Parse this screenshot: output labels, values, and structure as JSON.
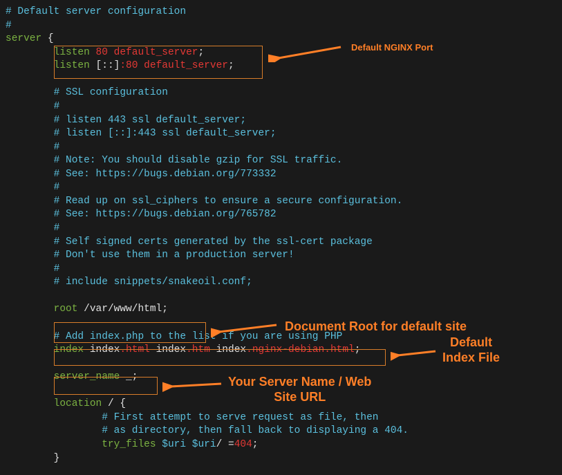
{
  "code": {
    "l1": "# Default server configuration",
    "l2": "#",
    "l3a": "server",
    "l3b": " {",
    "listen_kw": "listen",
    "port80": "80",
    "def_srv": "default_server",
    "semi": ";",
    "bracket6a": "[::]",
    "colon80": ":80",
    "c_sslconf": "# SSL configuration",
    "c_hash": "#",
    "c_listen443": "# listen 443 ssl default_server;",
    "c_listen443b": "# listen [::]:443 ssl default_server;",
    "c_note": "# Note: You should disable gzip for SSL traffic.",
    "c_see1": "# See: https://bugs.debian.org/773332",
    "c_read": "# Read up on ssl_ciphers to ensure a secure configuration.",
    "c_see2": "# See: https://bugs.debian.org/765782",
    "c_self": "# Self signed certs generated by the ssl-cert package",
    "c_dont": "# Don't use them in a production server!",
    "c_inc": "# include snippets/snakeoil.conf;",
    "root_kw": "root",
    "root_path": " /var/www/html",
    "c_addphp": "# Add index.php to the list if you are using PHP",
    "index_kw": "index",
    "idx1a": " index",
    "idx1b": ".html",
    "idx2a": " index",
    "idx2b": ".htm",
    "idx3a": " index",
    "idx3b": ".nginx-debian.html",
    "sname_kw": "server_name",
    "sname_val": " _",
    "loc_kw": "location",
    "loc_path": " / ",
    "brace_open": "{",
    "c_first": "# First attempt to serve request as file, then",
    "c_asdir": "# as directory, then fall back to displaying a 404.",
    "try_kw": "try_files",
    "uri": " $uri $uri",
    "slash": "/ ",
    "eq": "=",
    "e404": "404",
    "brace_close": "}"
  },
  "annotations": {
    "a1": "Default NGINX Port",
    "a2": "Document Root for default site",
    "a3a": "Default",
    "a3b": "Index File",
    "a4a": "Your Server Name / Web",
    "a4b": "Site URL"
  }
}
